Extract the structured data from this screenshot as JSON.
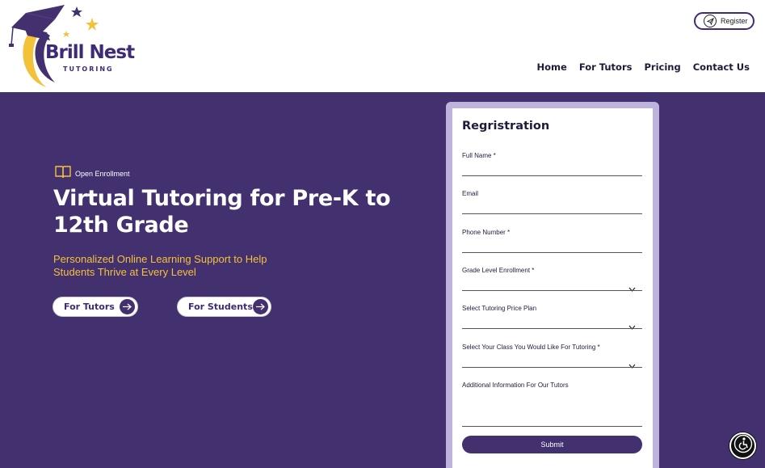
{
  "header": {
    "logo": {
      "brand": "Brill Nest",
      "sub": "TUTORING"
    },
    "register_label": "Register",
    "nav": [
      "Home",
      "For Tutors",
      "Pricing",
      "Contact Us"
    ]
  },
  "hero": {
    "badge": "Open Enrollment",
    "title": "Virtual Tutoring for Pre-K to 12th Grade",
    "subtitle": "Personalized Online Learning Support to Help Students Thrive at Every Level",
    "buttons": {
      "tutors": "For Tutors",
      "students": "For Students"
    }
  },
  "form": {
    "title": "Regristration",
    "fields": [
      {
        "label": "Full Name *",
        "type": "text",
        "value": ""
      },
      {
        "label": "Email",
        "type": "text",
        "value": ""
      },
      {
        "label": "Phone Number *",
        "type": "text",
        "value": ""
      },
      {
        "label": "Grade Level Enrollment *",
        "type": "select",
        "value": ""
      },
      {
        "label": "Select Tutoring Price Plan",
        "type": "select",
        "value": ""
      },
      {
        "label": "Select Your Class You Would Like For Tutoring *",
        "type": "select",
        "value": ""
      },
      {
        "label": "Additional Information For Our Tutors",
        "type": "textarea",
        "value": ""
      }
    ],
    "submit_label": "Submit"
  },
  "colors": {
    "primary": "#43306f",
    "accent": "#f3c13a",
    "card_border": "#bdb3dc"
  },
  "icons": {
    "register": "send-icon",
    "badge": "book-icon",
    "buttons": "arrow-right-icon",
    "select": "chevron-down-icon",
    "accessibility": "accessibility-icon"
  }
}
